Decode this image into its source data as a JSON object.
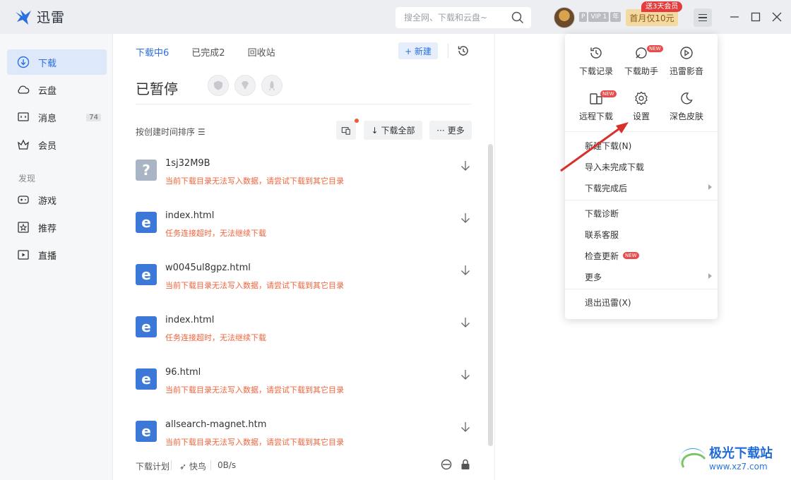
{
  "app": {
    "name": "迅雷"
  },
  "search": {
    "placeholder": "搜全网、下载和云盘~"
  },
  "account": {
    "vip_p": "P",
    "vip_level": "VIP 1",
    "vip_year": "年",
    "promo_label": "首月仅10元",
    "promo_tag": "送3天会员"
  },
  "sidebar": {
    "items": [
      {
        "label": "下载",
        "icon": "download-icon",
        "active": true
      },
      {
        "label": "云盘",
        "icon": "cloud-icon"
      },
      {
        "label": "消息",
        "icon": "message-icon",
        "count": "74"
      },
      {
        "label": "会员",
        "icon": "crown-icon"
      }
    ],
    "section_label": "发现",
    "discover": [
      {
        "label": "游戏",
        "icon": "gamepad-icon"
      },
      {
        "label": "推荐",
        "icon": "star-icon"
      },
      {
        "label": "直播",
        "icon": "live-icon"
      }
    ]
  },
  "main": {
    "tabs": [
      {
        "label": "下载中6",
        "active": true
      },
      {
        "label": "已完成2"
      },
      {
        "label": "回收站"
      }
    ],
    "new_button": "+ 新建",
    "paused_title": "已暂停",
    "sort_label": "按创建时间排序",
    "download_all": "下载全部",
    "more": "更多",
    "items": [
      {
        "name": "1sj32M9B",
        "error": "当前下载目录无法写入数据，请尝试下载到其它目录",
        "type": "unknown"
      },
      {
        "name": "index.html",
        "error": "任务连接超时，无法继续下载",
        "type": "ie"
      },
      {
        "name": "w0045ul8gpz.html",
        "error": "当前下载目录无法写入数据，请尝试下载到其它目录",
        "type": "ie"
      },
      {
        "name": "index.html",
        "error": "任务连接超时，无法继续下载",
        "type": "ie"
      },
      {
        "name": "96.html",
        "error": "当前下载目录无法写入数据，请尝试下载到其它目录",
        "type": "ie"
      },
      {
        "name": "allsearch-magnet.htm",
        "error": "当前下载目录无法写入数据，请尝试下载到其它目录",
        "type": "ie"
      }
    ],
    "footer": {
      "plan": "下载计划",
      "bird": "快鸟",
      "speed": "0B/s"
    }
  },
  "menu": {
    "quick": [
      {
        "label": "下载记录",
        "icon": "history-icon"
      },
      {
        "label": "下载助手",
        "icon": "assistant-icon",
        "badge": "NEW"
      },
      {
        "label": "迅雷影音",
        "icon": "player-icon"
      },
      {
        "label": "远程下载",
        "icon": "remote-icon",
        "badge": "NEW"
      },
      {
        "label": "设置",
        "icon": "gear-icon"
      },
      {
        "label": "深色皮肤",
        "icon": "moon-icon"
      }
    ],
    "items": [
      {
        "label": "新建下载(N)"
      },
      {
        "label": "导入未完成下载"
      },
      {
        "label": "下载完成后",
        "submenu": true
      },
      {
        "label": "下载诊断"
      },
      {
        "label": "联系客服"
      },
      {
        "label": "检查更新",
        "badge": "NEW"
      },
      {
        "label": "更多",
        "submenu": true
      },
      {
        "label": "退出迅雷(X)"
      }
    ]
  },
  "watermark": {
    "title": "极光下载站",
    "url": "www.xz7.com"
  },
  "colors": {
    "accent": "#2b6fe0",
    "error": "#f0643c",
    "badge_red": "#e94a4a",
    "promo": "#f4d9a2"
  }
}
